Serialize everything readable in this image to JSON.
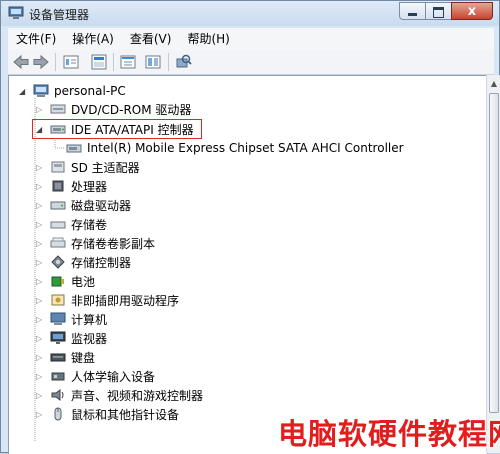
{
  "window": {
    "title": "设备管理器"
  },
  "window_controls": {
    "minimize": "–",
    "maximize": "□",
    "close": "x"
  },
  "menu": [
    {
      "label": "文件(F)"
    },
    {
      "label": "操作(A)"
    },
    {
      "label": "查看(V)"
    },
    {
      "label": "帮助(H)"
    }
  ],
  "toolbar": {
    "buttons": [
      "back-icon",
      "forward-icon",
      "properties-icon",
      "help-icon",
      "view-icon",
      "scan-hardware-icon"
    ]
  },
  "tree": {
    "root": "personal-PC",
    "items": [
      {
        "label": "DVD/CD-ROM 驱动器",
        "expanded": false,
        "icon": "dvd-drive-icon"
      },
      {
        "label": "IDE ATA/ATAPI 控制器",
        "expanded": true,
        "highlighted": true,
        "icon": "ide-controller-icon",
        "children": [
          {
            "label": "Intel(R) Mobile Express Chipset SATA AHCI Controller",
            "icon": "controller-device-icon"
          }
        ]
      },
      {
        "label": "SD 主适配器",
        "expanded": false,
        "icon": "sd-host-icon"
      },
      {
        "label": "处理器",
        "expanded": false,
        "icon": "processor-icon"
      },
      {
        "label": "磁盘驱动器",
        "expanded": false,
        "icon": "disk-drive-icon"
      },
      {
        "label": "存储卷",
        "expanded": false,
        "icon": "storage-volume-icon"
      },
      {
        "label": "存储卷卷影副本",
        "expanded": false,
        "icon": "shadow-copy-icon"
      },
      {
        "label": "存储控制器",
        "expanded": false,
        "icon": "storage-controller-icon"
      },
      {
        "label": "电池",
        "expanded": false,
        "icon": "battery-icon"
      },
      {
        "label": "非即插即用驱动程序",
        "expanded": false,
        "icon": "non-pnp-driver-icon"
      },
      {
        "label": "计算机",
        "expanded": false,
        "icon": "computer-icon"
      },
      {
        "label": "监视器",
        "expanded": false,
        "icon": "monitor-icon"
      },
      {
        "label": "键盘",
        "expanded": false,
        "icon": "keyboard-icon"
      },
      {
        "label": "人体学输入设备",
        "expanded": false,
        "icon": "hid-icon"
      },
      {
        "label": "声音、视频和游戏控制器",
        "expanded": false,
        "icon": "sound-icon"
      },
      {
        "label": "鼠标和其他指针设备",
        "expanded": false,
        "icon": "mouse-icon"
      }
    ]
  },
  "watermark": "电脑软硬件教程网",
  "colors": {
    "highlight": "#e0242b",
    "watermark": "#e21d1d"
  }
}
